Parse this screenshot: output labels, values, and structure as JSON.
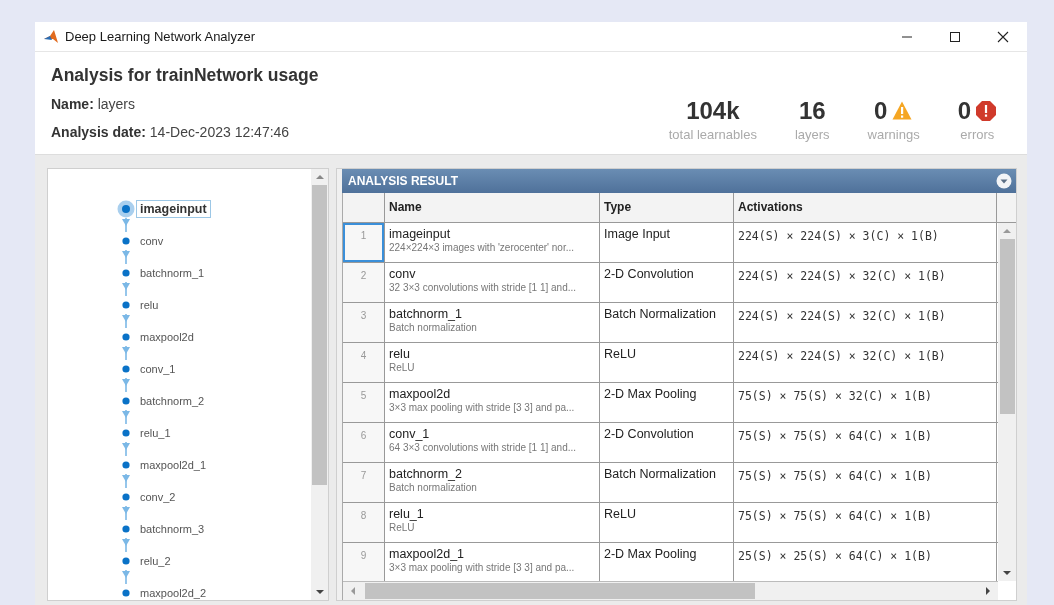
{
  "window": {
    "title": "Deep Learning Network Analyzer"
  },
  "summary": {
    "title": "Analysis for trainNetwork usage",
    "fields": [
      {
        "text": "**Name:** layers"
      },
      {
        "text": "**Analysis date:** 14-Dec-2023 12:47:46"
      }
    ],
    "stats": [
      {
        "value": "104k",
        "label": "total learnables",
        "kind": "plain"
      },
      {
        "value": "16",
        "label": "layers",
        "kind": "plain"
      },
      {
        "value": "0",
        "label": "warnings",
        "kind": "warning"
      },
      {
        "value": "0",
        "label": "errors",
        "kind": "error"
      }
    ]
  },
  "graph": {
    "nodes": [
      {
        "label": "imageinput",
        "selected": true
      },
      {
        "label": "conv",
        "selected": false
      },
      {
        "label": "batchnorm_1",
        "selected": false
      },
      {
        "label": "relu",
        "selected": false
      },
      {
        "label": "maxpool2d",
        "selected": false
      },
      {
        "label": "conv_1",
        "selected": false
      },
      {
        "label": "batchnorm_2",
        "selected": false
      },
      {
        "label": "relu_1",
        "selected": false
      },
      {
        "label": "maxpool2d_1",
        "selected": false
      },
      {
        "label": "conv_2",
        "selected": false
      },
      {
        "label": "batchnorm_3",
        "selected": false
      },
      {
        "label": "relu_2",
        "selected": false
      },
      {
        "label": "maxpool2d_2",
        "selected": false
      }
    ]
  },
  "results": {
    "title": "ANALYSIS RESULT",
    "columns": [
      "Name",
      "Type",
      "Activations"
    ],
    "rows": [
      {
        "number": "1",
        "name": "imageinput",
        "description": "224×224×3 images with 'zerocenter' nor...",
        "type": "Image Input",
        "activations": "224(S) × 224(S) × 3(C) × 1(B)",
        "selected": true
      },
      {
        "number": "2",
        "name": "conv",
        "description": "32 3×3 convolutions with stride [1 1] and...",
        "type": "2-D Convolution",
        "activations": "224(S) × 224(S) × 32(C) × 1(B)",
        "selected": false
      },
      {
        "number": "3",
        "name": "batchnorm_1",
        "description": "Batch normalization",
        "type": "Batch Normalization",
        "activations": "224(S) × 224(S) × 32(C) × 1(B)",
        "selected": false
      },
      {
        "number": "4",
        "name": "relu",
        "description": "ReLU",
        "type": "ReLU",
        "activations": "224(S) × 224(S) × 32(C) × 1(B)",
        "selected": false
      },
      {
        "number": "5",
        "name": "maxpool2d",
        "description": "3×3 max pooling with stride [3 3] and pa...",
        "type": "2-D Max Pooling",
        "activations": "75(S) × 75(S) × 32(C) × 1(B)",
        "selected": false
      },
      {
        "number": "6",
        "name": "conv_1",
        "description": "64 3×3 convolutions with stride [1 1] and...",
        "type": "2-D Convolution",
        "activations": "75(S) × 75(S) × 64(C) × 1(B)",
        "selected": false
      },
      {
        "number": "7",
        "name": "batchnorm_2",
        "description": "Batch normalization",
        "type": "Batch Normalization",
        "activations": "75(S) × 75(S) × 64(C) × 1(B)",
        "selected": false
      },
      {
        "number": "8",
        "name": "relu_1",
        "description": "ReLU",
        "type": "ReLU",
        "activations": "75(S) × 75(S) × 64(C) × 1(B)",
        "selected": false
      },
      {
        "number": "9",
        "name": "maxpool2d_1",
        "description": "3×3 max pooling with stride [3 3] and pa...",
        "type": "2-D Max Pooling",
        "activations": "25(S) × 25(S) × 64(C) × 1(B)",
        "selected": false
      }
    ]
  }
}
